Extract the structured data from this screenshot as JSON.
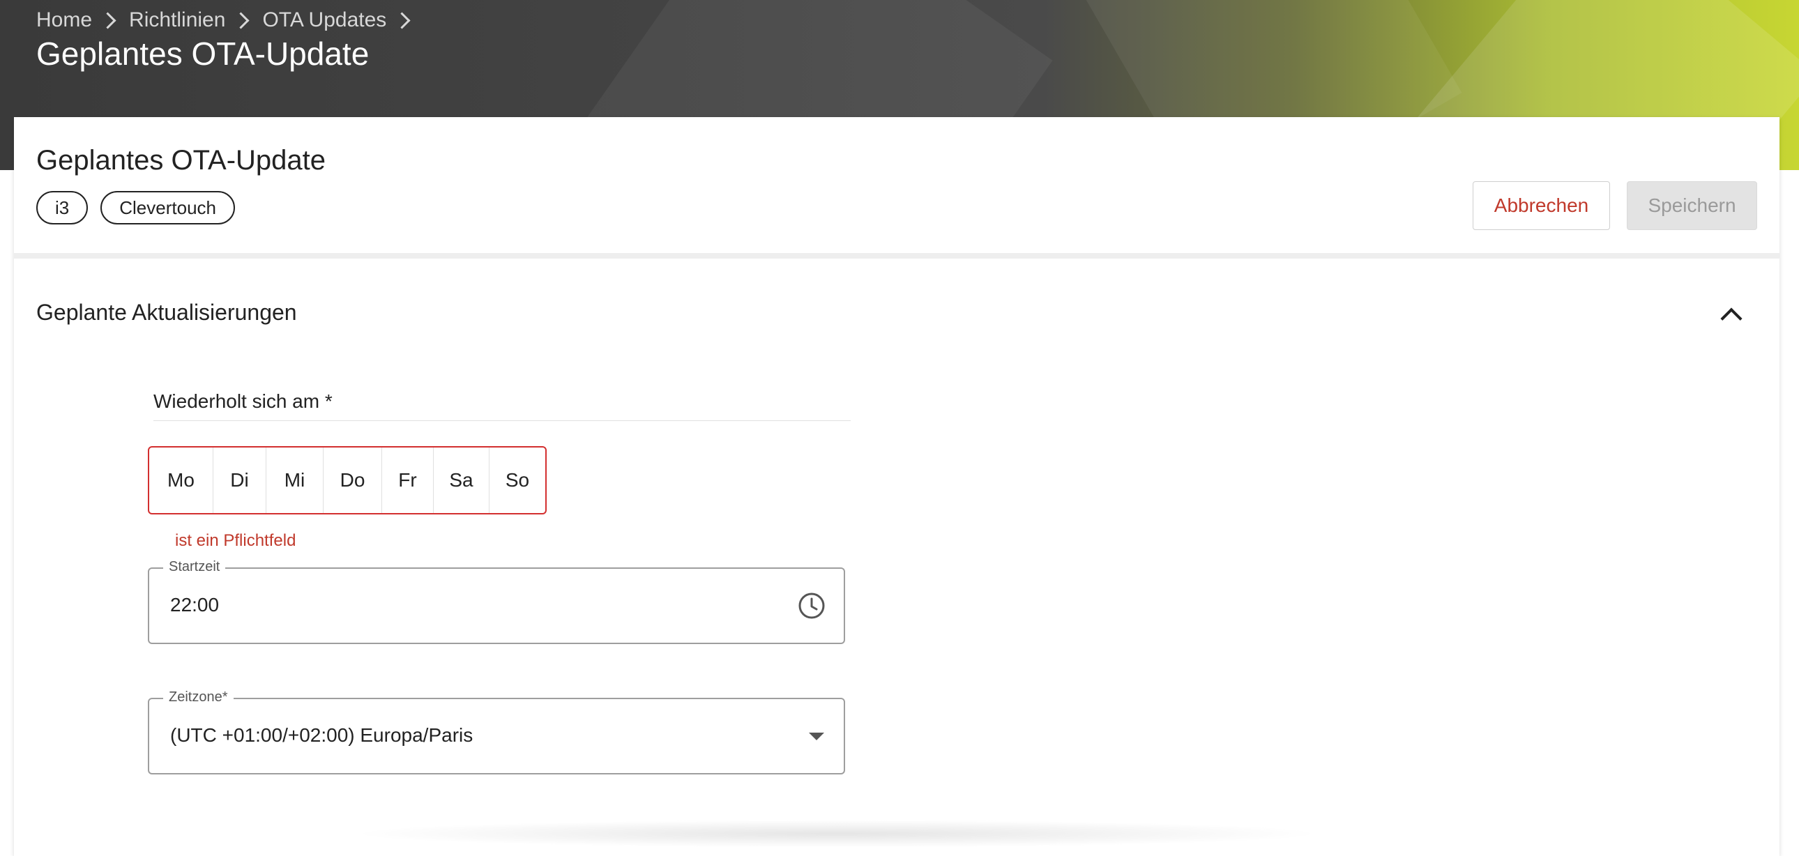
{
  "breadcrumb": {
    "items": [
      "Home",
      "Richtlinien",
      "OTA Updates"
    ]
  },
  "hero": {
    "title": "Geplantes OTA-Update"
  },
  "card": {
    "title": "Geplantes OTA-Update",
    "chips": [
      "i3",
      "Clevertouch"
    ],
    "cancel_label": "Abbrechen",
    "save_label": "Speichern"
  },
  "section": {
    "title": "Geplante Aktualisierungen",
    "repeat_label": "Wiederholt sich am *",
    "days": [
      "Mo",
      "Di",
      "Mi",
      "Do",
      "Fr",
      "Sa",
      "So"
    ],
    "error": "ist ein Pflichtfeld",
    "start_time": {
      "label": "Startzeit",
      "value": "22:00"
    },
    "timezone": {
      "label": "Zeitzone*",
      "value": "(UTC +01:00/+02:00) Europa/Paris"
    }
  },
  "colors": {
    "accent_red": "#c0392b",
    "error_border": "#d32f2f",
    "hero_green": "#c7d633"
  }
}
